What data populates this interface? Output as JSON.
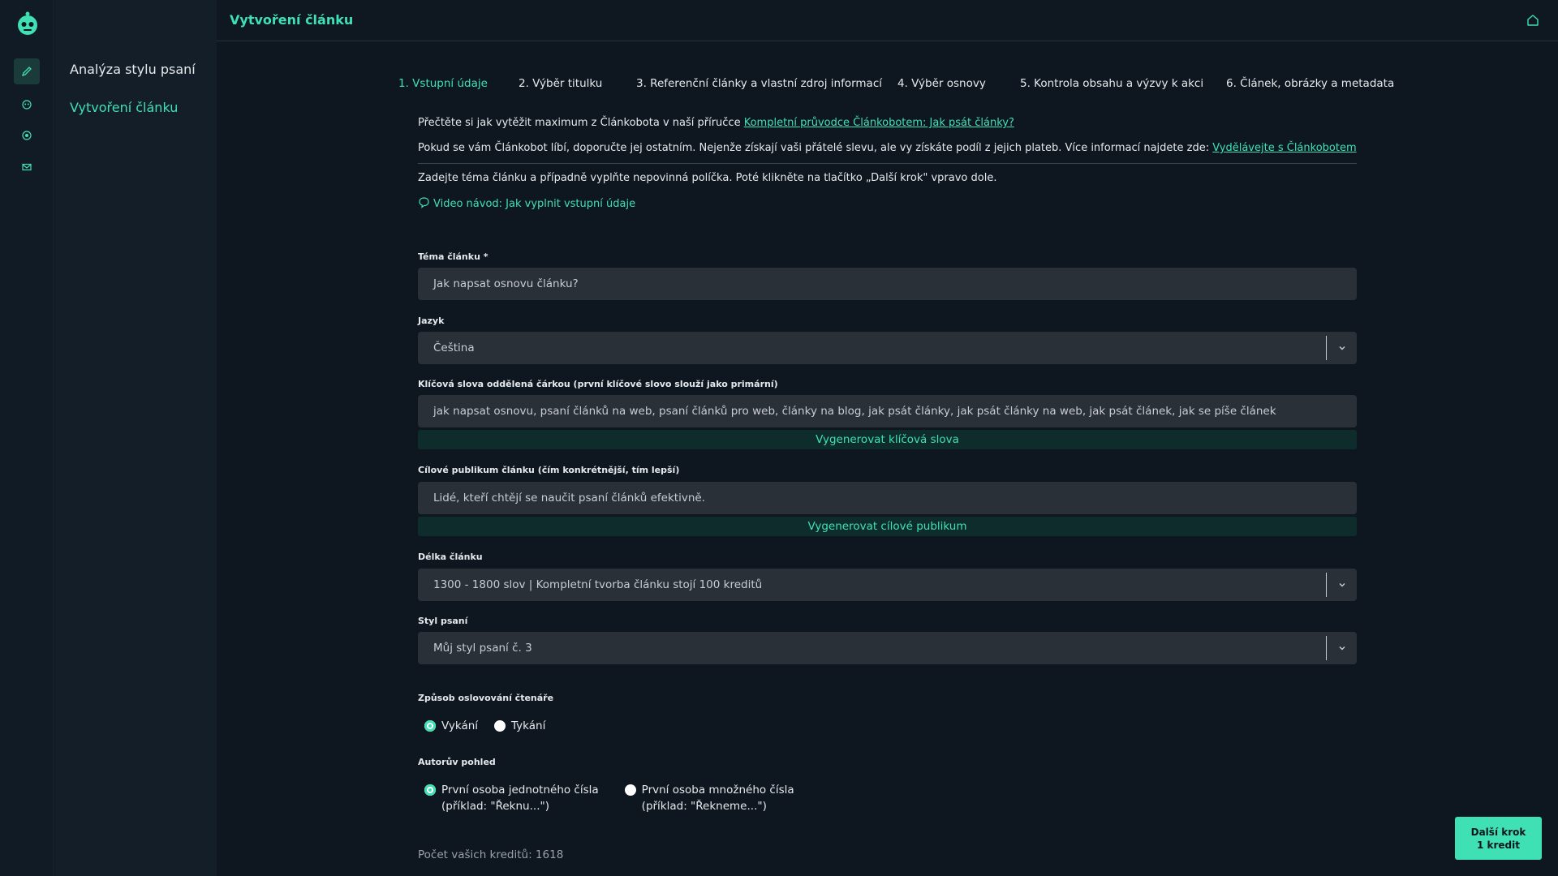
{
  "sidebar": {
    "items": [
      {
        "label": "Analýza stylu psaní"
      },
      {
        "label": "Vytvoření článku"
      }
    ]
  },
  "header": {
    "title": "Vytvoření článku"
  },
  "steps": [
    "1. Vstupní údaje",
    "2. Výběr titulku",
    "3. Referenční články a vlastní zdroj informací",
    "4. Výběr osnovy",
    "5. Kontrola obsahu a výzvy k akci",
    "6. Článek, obrázky a metadata"
  ],
  "info": {
    "guide_text": "Přečtěte si jak vytěžit maximum z Článkobota v naší příručce ",
    "guide_link": "Kompletní průvodce Článkobotem: Jak psát články?",
    "referral_text": "Pokud se vám Článkobot líbí, doporučte jej ostatním. Nejenže získají vaši přátelé slevu, ale vy získáte podíl z jejich plateb. Více informací najdete zde: ",
    "referral_link": "Vydělávejte s Článkobotem",
    "instructions": "Zadejte téma článku a případně vyplňte nepovinná políčka. Poté klikněte na tlačítko „Další krok\" vpravo dole.",
    "video_link": "Video návod: Jak vyplnit vstupní údaje"
  },
  "form": {
    "topic": {
      "label": "Téma článku *",
      "placeholder": "Jak napsat osnovu článku?"
    },
    "language": {
      "label": "Jazyk",
      "value": "Čeština"
    },
    "keywords": {
      "label": "Klíčová slova oddělená čárkou (první klíčové slovo slouží jako primární)",
      "value": "jak napsat osnovu, psaní článků na web, psaní článků pro web, články na blog, jak psát články, jak psát články na web, jak psát článek, jak se píše článek",
      "generate_label": "Vygenerovat klíčová slova"
    },
    "audience": {
      "label": "Cílové publikum článku (čím konkrétnější, tím lepší)",
      "value": "Lidé, kteří chtějí se naučit psaní článků efektivně.",
      "generate_label": "Vygenerovat cílové publikum"
    },
    "length": {
      "label": "Délka článku",
      "value": "1300 - 1800 slov | Kompletní tvorba článku stojí 100 kreditů"
    },
    "style": {
      "label": "Styl psaní",
      "value": "Můj styl psaní č. 3"
    },
    "address": {
      "label": "Způsob oslovování čtenáře",
      "options": [
        {
          "label": "Vykání",
          "checked": true
        },
        {
          "label": "Tykání",
          "checked": false
        }
      ]
    },
    "perspective": {
      "label": "Autorův pohled",
      "options": [
        {
          "line1": "První osoba jednotného čísla",
          "line2": "(příklad: \"Řeknu...\")",
          "checked": true
        },
        {
          "line1": "První osoba množného čísla",
          "line2": "(příklad: \"Řekneme...\")",
          "checked": false
        }
      ]
    }
  },
  "credits_text": "Počet vašich kreditů: 1618",
  "next_button": {
    "label": "Další krok",
    "sub": "1 kredit"
  },
  "colors": {
    "accent": "#3fe0b4",
    "background": "#0e1720",
    "field": "#2a3038"
  }
}
